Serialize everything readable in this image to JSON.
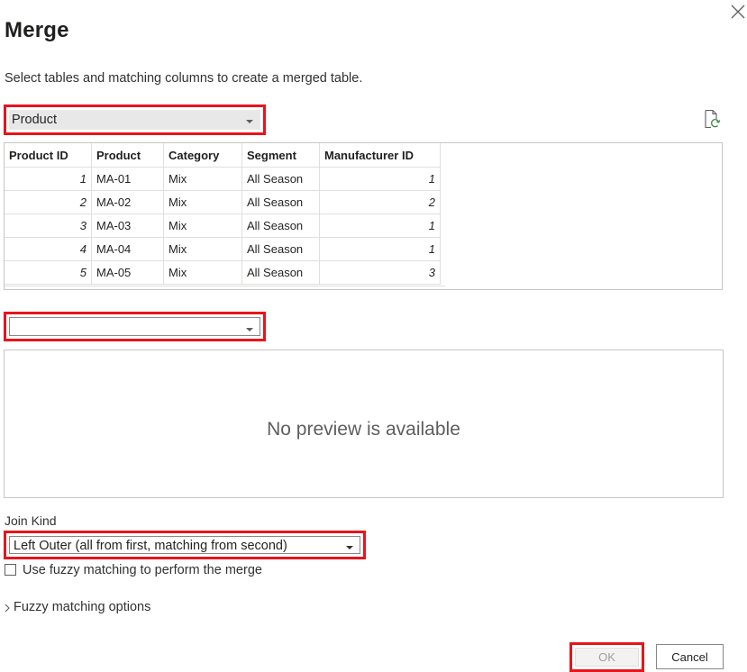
{
  "dialog": {
    "title": "Merge",
    "subtitle": "Select tables and matching columns to create a merged table.",
    "close_icon": "close-icon"
  },
  "first_table": {
    "selected": "Product",
    "refresh_icon": "refresh-document-icon",
    "columns": [
      "Product ID",
      "Product",
      "Category",
      "Segment",
      "Manufacturer ID"
    ],
    "rows": [
      [
        "1",
        "MA-01",
        "Mix",
        "All Season",
        "1"
      ],
      [
        "2",
        "MA-02",
        "Mix",
        "All Season",
        "2"
      ],
      [
        "3",
        "MA-03",
        "Mix",
        "All Season",
        "1"
      ],
      [
        "4",
        "MA-04",
        "Mix",
        "All Season",
        "1"
      ],
      [
        "5",
        "MA-05",
        "Mix",
        "All Season",
        "3"
      ]
    ]
  },
  "second_table": {
    "selected": "",
    "empty_message": "No preview is available"
  },
  "join": {
    "label": "Join Kind",
    "selected": "Left Outer (all from first, matching from second)"
  },
  "fuzzy": {
    "checkbox_label": "Use fuzzy matching to perform the merge",
    "checked": false,
    "options_label": "Fuzzy matching options"
  },
  "footer": {
    "ok_label": "OK",
    "cancel_label": "Cancel"
  },
  "colors": {
    "highlight": "#e8141b",
    "ok_disabled_text": "#a19f9d"
  }
}
